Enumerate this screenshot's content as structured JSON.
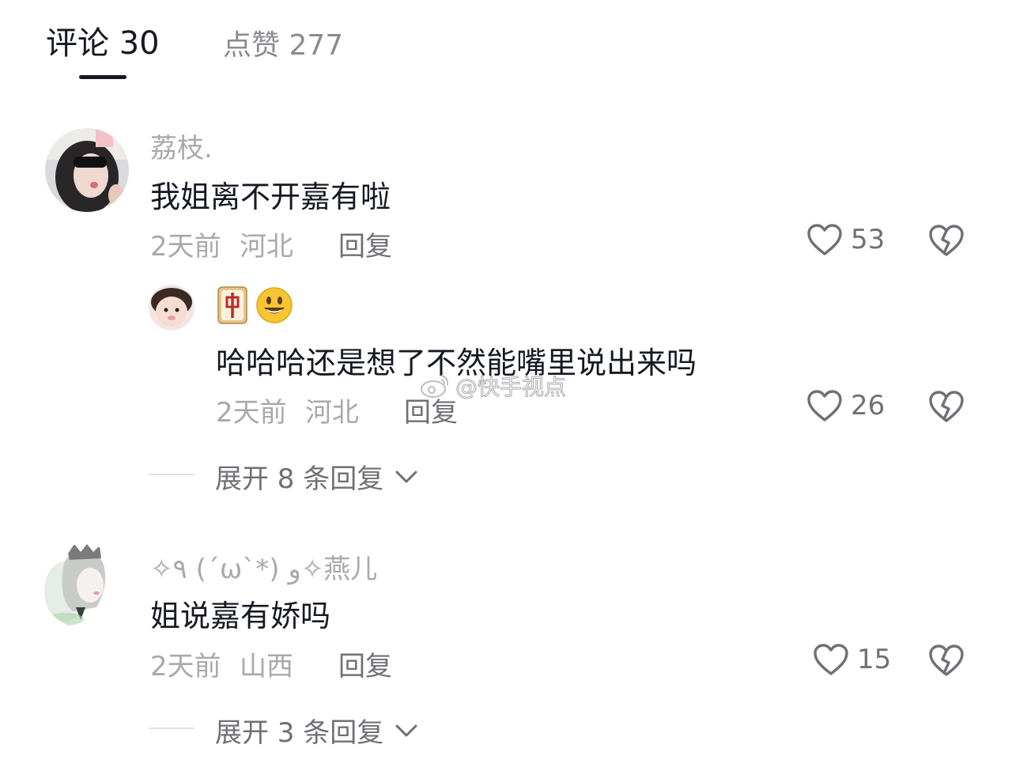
{
  "tabs": {
    "comments_label": "评论 30",
    "likes_label": "点赞 277"
  },
  "comments": [
    {
      "username": "荔枝.",
      "content": "我姐离不开嘉有啦",
      "time": "2天前",
      "location": "河北",
      "reply_label": "回复",
      "likes": "53",
      "replies": [
        {
          "username_emoji": "🀄😃",
          "content": "哈哈哈还是想了不然能嘴里说出来吗",
          "time": "2天前",
          "location": "河北",
          "reply_label": "回复",
          "likes": "26"
        }
      ],
      "expand_label": "展开 8 条回复"
    },
    {
      "username": "✧٩ (ˊωˋ*) و✧燕儿",
      "content": "姐说嘉有娇吗",
      "time": "2天前",
      "location": "山西",
      "reply_label": "回复",
      "likes": "15",
      "expand_label": "展开 3 条回复"
    }
  ],
  "watermark": "@快手视点",
  "colors": {
    "text_primary": "#161823",
    "text_secondary": "#a8a9ae",
    "text_action": "#6f7077"
  }
}
